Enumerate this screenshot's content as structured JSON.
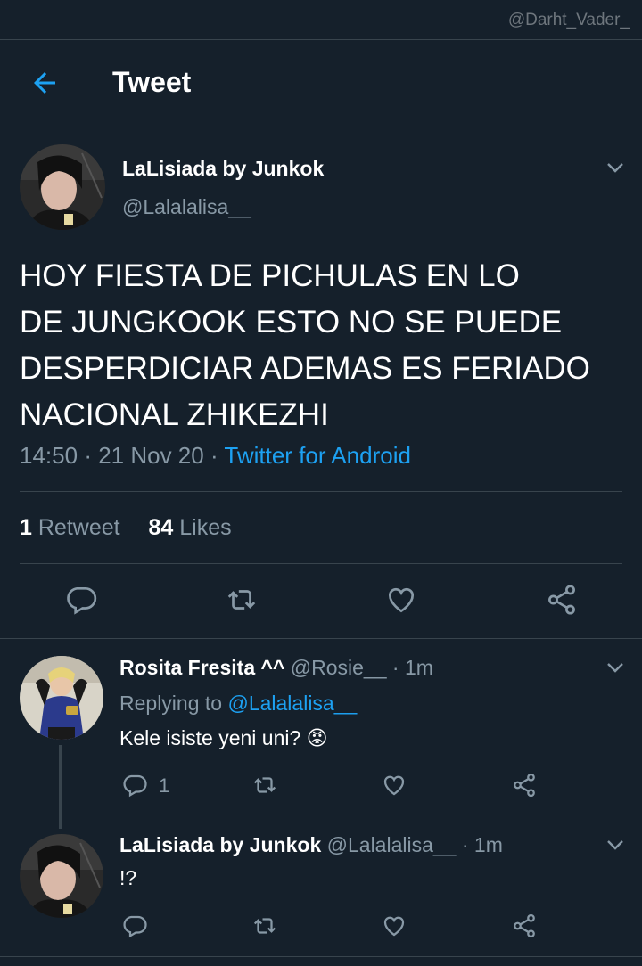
{
  "watermark": "@Darht_Vader_",
  "header": {
    "title": "Tweet"
  },
  "main_tweet": {
    "name": "LaLisiada by Junkok",
    "handle": "@Lalalalisa__",
    "text_lines": [
      "HOY FIESTA DE PICHULAS EN LO",
      "DE JUNGKOOK ESTO NO SE PUEDE",
      "DESPERDICIAR ADEMAS ES FERIADO",
      "NACIONAL ZHIKEZHI"
    ],
    "time": "14:50",
    "date": "21 Nov 20",
    "source": "Twitter for Android",
    "retweets_count": "1",
    "retweets_label": "Retweet",
    "likes_count": "84",
    "likes_label": "Likes"
  },
  "replies": [
    {
      "name": "Rosita Fresita ^^",
      "handle": "@Rosie__",
      "time": "1m",
      "replying_prefix": "Replying to",
      "replying_to": "@Lalalalisa__",
      "text": "Kele isiste yeni uni? 😡",
      "reply_count": "1"
    },
    {
      "name": "LaLisiada by Junkok",
      "handle": "@Lalalalisa__",
      "time": "1m",
      "text": "!?"
    }
  ],
  "colors": {
    "background": "#15202b",
    "accent": "#1da1f2",
    "muted": "#8899a6",
    "divider": "#38444d"
  },
  "icons": [
    "back-arrow-icon",
    "chevron-down-icon",
    "reply-icon",
    "retweet-icon",
    "like-icon",
    "share-icon"
  ]
}
